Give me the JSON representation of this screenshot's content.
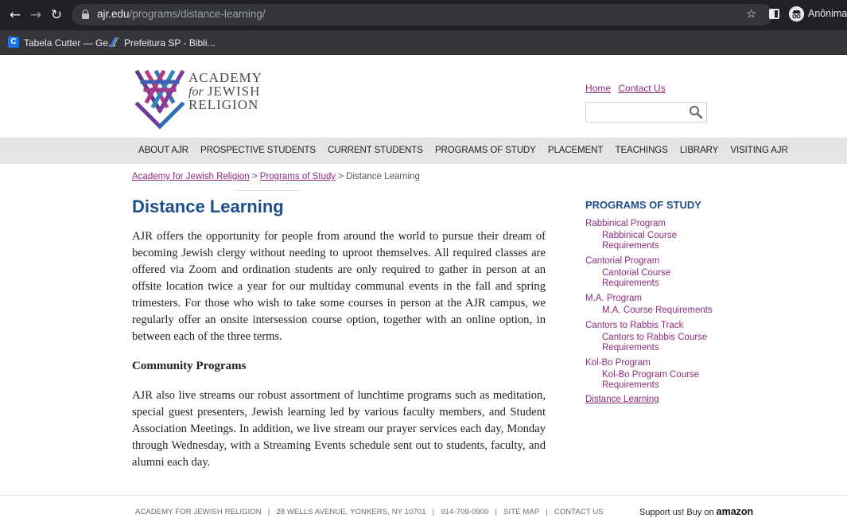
{
  "browser": {
    "url_host": "ajr.edu",
    "url_path": "/programs/distance-learning/",
    "profile_name": "Anônima",
    "bookmarks": [
      {
        "label": "Tabela Cutter — Ge..."
      },
      {
        "label": "Prefeitura SP - Bibli..."
      }
    ],
    "icons": [
      "back-arrow",
      "forward-arrow",
      "reload",
      "lock",
      "star",
      "side-panel",
      "incognito"
    ]
  },
  "site": {
    "logo": {
      "line1": "ACADEMY",
      "line2_prefix": "for",
      "line2": "JEWISH",
      "line3": "RELIGION"
    },
    "header_links": {
      "home": "Home",
      "contact": "Contact Us"
    },
    "nav": [
      "ABOUT AJR",
      "PROSPECTIVE STUDENTS",
      "CURRENT STUDENTS",
      "PROGRAMS OF STUDY",
      "PLACEMENT",
      "TEACHINGS",
      "LIBRARY",
      "VISITING AJR"
    ],
    "breadcrumb": {
      "level1": "Academy for Jewish Religion",
      "level2": "Programs of Study",
      "current": "Distance Learning",
      "sep": ">"
    }
  },
  "main": {
    "title": "Distance Learning",
    "para1": "AJR offers the opportunity for people from around the world to pursue their dream of becoming Jewish clergy without needing to uproot themselves. All required classes are offered via Zoom and ordination students are only required to gather in person at an offsite location twice a year for our multiday communal events in the fall and spring trimesters. For those who wish to take some courses in person at the AJR campus, we regularly offer an onsite intersession course option, together with an online option, in between each of the three terms.",
    "subheading": "Community Programs",
    "para2": "AJR also live streams our robust assortment of lunchtime programs such as meditation, special guest presenters, Jewish learning led by various faculty members, and Student Association Meetings. In addition, we live stream our prayer services each day, Monday through Wednesday, with a Streaming Events schedule sent out to students, faculty, and alumni each day."
  },
  "sidebar": {
    "title": "PROGRAMS OF STUDY",
    "groups": [
      {
        "main": "Rabbinical Program",
        "sub": "Rabbinical Course Requirements"
      },
      {
        "main": "Cantorial Program",
        "sub": "Cantorial Course Requirements"
      },
      {
        "main": "M.A. Program",
        "sub": "M.A. Course Requirements"
      },
      {
        "main": "Cantors to Rabbis Track",
        "sub": "Cantors to Rabbis Course Requirements"
      },
      {
        "main": "Kol-Bo Program",
        "sub": "Kol-Bo Program Course Requirements"
      }
    ],
    "last": "Distance Learning"
  },
  "footer": {
    "org": "ACADEMY FOR JEWISH RELIGION",
    "address": "28 WELLS AVENUE, YONKERS, NY 10701",
    "phone": "914-709-0900",
    "sitemap": "SITE MAP",
    "contact": "CONTACT US",
    "sep": "|",
    "support": "Support us! Buy on",
    "amazon": "amazon"
  },
  "colors": {
    "brand_blue": "#1f4e8c",
    "link_purple": "#8c2c7d",
    "nav_bg": "#e4e4e4",
    "chrome_dark": "#202124"
  }
}
